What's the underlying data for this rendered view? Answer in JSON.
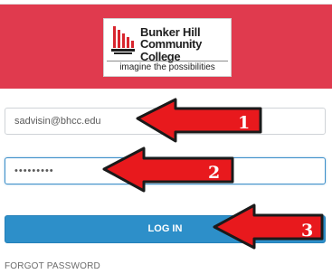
{
  "header": {
    "logo": {
      "line1": "Bunker Hill",
      "line2": "Community College",
      "tagline": "imagine the possibilities"
    },
    "background_color": "#e03a4e"
  },
  "form": {
    "email_value": "sadvisin@bhcc.edu",
    "password_value": "•••••••••",
    "login_label": "LOG IN",
    "forgot_label": "FORGOT PASSWORD"
  },
  "annotations": {
    "arrow1_number": "1",
    "arrow2_number": "2",
    "arrow3_number": "3",
    "arrow_color": "#e8191d"
  }
}
